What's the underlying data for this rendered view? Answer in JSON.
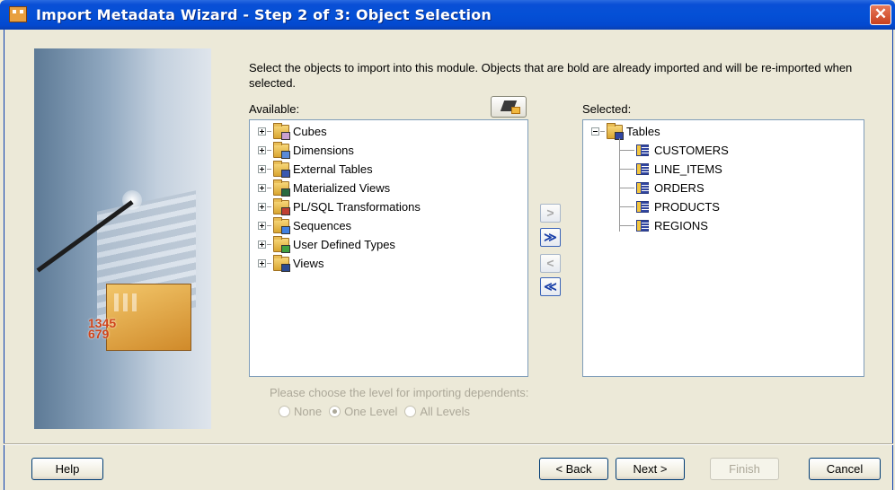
{
  "window": {
    "title": "Import Metadata Wizard - Step 2 of 3: Object Selection",
    "close_glyph": "✕"
  },
  "instructions": "Select the objects to import into this module. Objects that are bold are already imported and will be re-imported when selected.",
  "available": {
    "label": "Available:",
    "items": [
      {
        "label": "Cubes",
        "icon": "cube-folder-icon"
      },
      {
        "label": "Dimensions",
        "icon": "dimension-folder-icon"
      },
      {
        "label": "External Tables",
        "icon": "external-table-folder-icon"
      },
      {
        "label": "Materialized Views",
        "icon": "materialized-view-folder-icon"
      },
      {
        "label": "PL/SQL Transformations",
        "icon": "plsql-folder-icon"
      },
      {
        "label": "Sequences",
        "icon": "sequence-folder-icon"
      },
      {
        "label": "User Defined Types",
        "icon": "user-type-folder-icon"
      },
      {
        "label": "Views",
        "icon": "view-folder-icon"
      }
    ]
  },
  "selected": {
    "label": "Selected:",
    "root": "Tables",
    "items": [
      "CUSTOMERS",
      "LINE_ITEMS",
      "ORDERS",
      "PRODUCTS",
      "REGIONS"
    ]
  },
  "move_buttons": {
    "add": ">",
    "add_all": "≫",
    "remove": "<",
    "remove_all": "≪"
  },
  "dependents": {
    "prompt": "Please choose the level for importing dependents:",
    "options": [
      "None",
      "One Level",
      "All Levels"
    ],
    "selected": "One Level"
  },
  "footer": {
    "help": "Help",
    "back": "< Back",
    "next": "Next >",
    "finish": "Finish",
    "cancel": "Cancel"
  }
}
